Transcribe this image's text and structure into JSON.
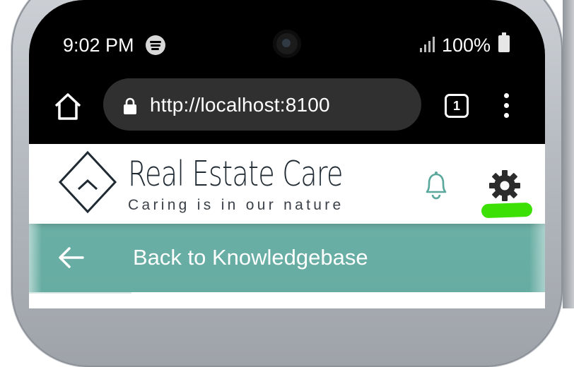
{
  "status_bar": {
    "time": "9:02 PM",
    "battery": "100%",
    "icons": [
      "spotify-icon",
      "signal-icon",
      "battery-icon"
    ]
  },
  "browser": {
    "url": "http://localhost:8100",
    "tab_count": "1",
    "icons": [
      "home-icon",
      "lock-icon",
      "tabs-icon",
      "menu-icon"
    ]
  },
  "app_header": {
    "brand": "Real Estate Care",
    "tagline": "Caring is in our nature",
    "icons": [
      "logo-icon",
      "bell-icon",
      "gear-icon"
    ]
  },
  "navbar": {
    "title": "Back to Knowledgebase",
    "icons": [
      "back-arrow-icon"
    ]
  },
  "colors": {
    "accent_teal": "#67aca2",
    "highlight_green": "#3de005",
    "bell": "#5aa79c",
    "gear": "#2b2b2b",
    "url_bar": "#303030"
  }
}
